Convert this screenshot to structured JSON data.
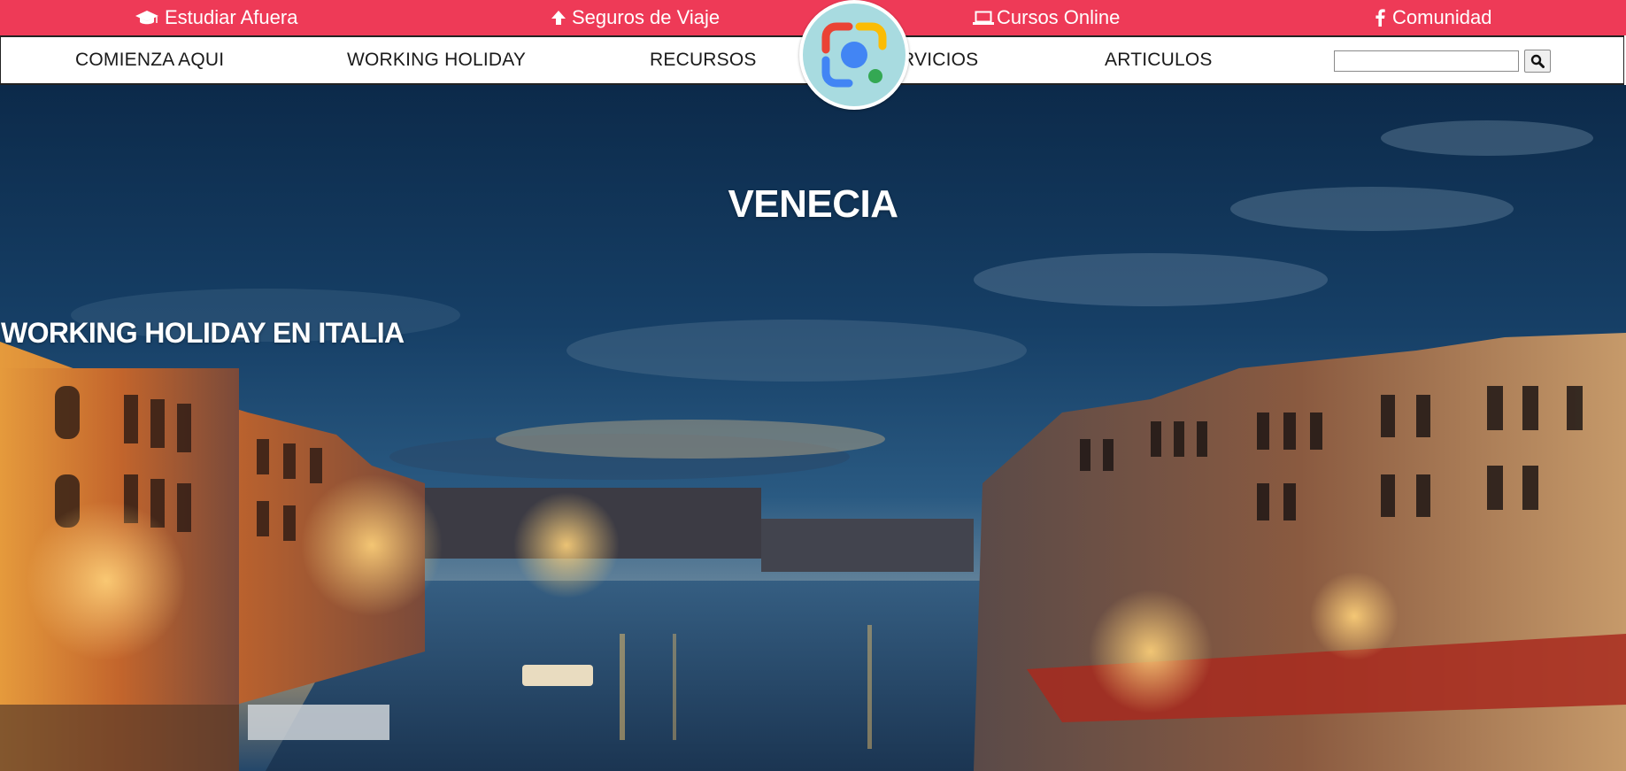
{
  "topbar": {
    "background": "#ee3a57",
    "links": [
      {
        "label": "Estudiar Afuera",
        "icon": "graduation-cap-icon"
      },
      {
        "label": "Seguros de Viaje",
        "icon": "arrow-up-icon"
      },
      {
        "label": "Cursos Online",
        "icon": "laptop-icon"
      },
      {
        "label": "Comunidad",
        "icon": "facebook-icon"
      }
    ]
  },
  "nav": {
    "items": [
      {
        "label": "COMIENZA AQUI"
      },
      {
        "label": "WORKING HOLIDAY"
      },
      {
        "label": "RECURSOS"
      },
      {
        "label": "RVICIOS"
      },
      {
        "label": "ARTICULOS"
      }
    ],
    "search": {
      "value": "",
      "placeholder": "",
      "button_icon": "search-icon"
    }
  },
  "overlay": {
    "icon": "google-lens-icon",
    "background": "#a8dbe0"
  },
  "hero": {
    "title": "VENECIA",
    "subtitle": "WORKING HOLIDAY EN ITALIA",
    "image": "venice-grand-canal-dusk"
  }
}
